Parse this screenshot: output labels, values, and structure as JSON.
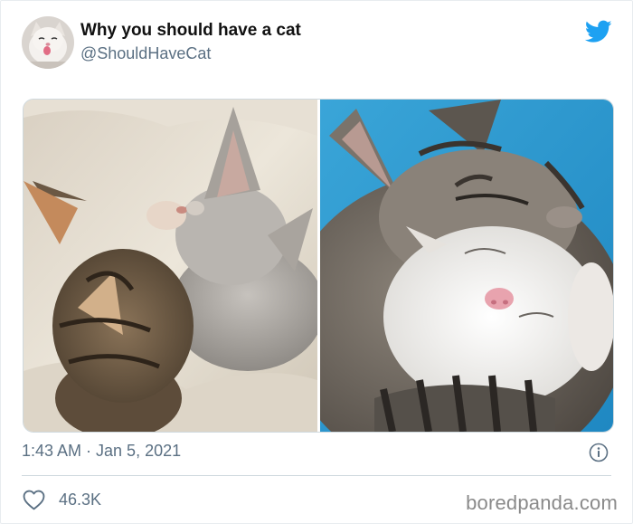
{
  "tweet": {
    "display_name": "Why you should have a cat",
    "handle": "@ShouldHaveCat",
    "timestamp": "1:43 AM · Jan 5, 2021",
    "likes": "46.3K"
  },
  "icons": {
    "brand": "twitter-bird-icon",
    "info": "info-icon",
    "like": "heart-icon"
  },
  "colors": {
    "twitter_blue": "#1da1f2",
    "secondary_text": "#5b7083",
    "divider": "#cfd9de"
  },
  "watermark": "boredpanda.com"
}
